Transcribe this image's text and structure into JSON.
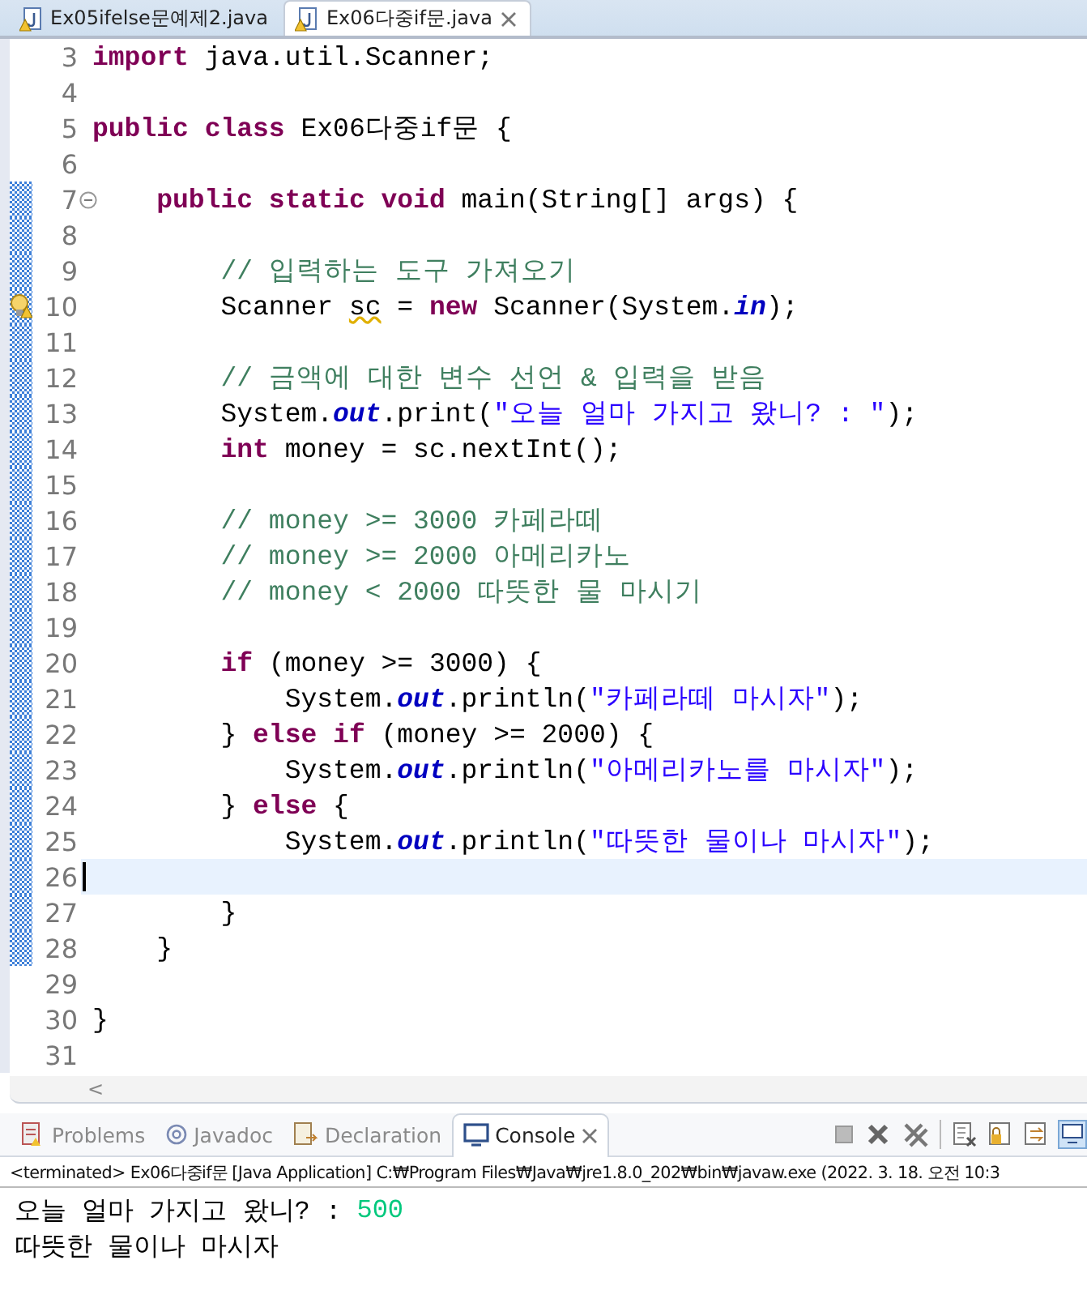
{
  "editor_tabs": [
    {
      "label": "Ex05ifelse문예제2.java",
      "selected": false
    },
    {
      "label": "Ex06다중if문.java",
      "selected": true
    }
  ],
  "code_lines": [
    {
      "number": "3",
      "kind": "code",
      "range": false,
      "current": false,
      "tokens": [
        {
          "kind": "kw",
          "text": "import"
        },
        {
          "kind": "plain",
          "text": " java.util.Scanner;"
        }
      ]
    },
    {
      "number": "4",
      "kind": "code",
      "range": false,
      "current": false
    },
    {
      "number": "5",
      "kind": "code",
      "range": false,
      "current": false,
      "tokens": [
        {
          "kind": "kw",
          "text": "public"
        },
        {
          "kind": "kw",
          "text": " class"
        },
        {
          "kind": "plain",
          "text": " Ex06다중if문 {"
        }
      ]
    },
    {
      "number": "6",
      "kind": "code",
      "range": false,
      "current": false
    },
    {
      "number": "7",
      "kind": "fold",
      "range": true,
      "current": false,
      "tokens": [
        {
          "kind": "kw",
          "text": "    public"
        },
        {
          "kind": "kw",
          "text": " static"
        },
        {
          "kind": "kw",
          "text": " void"
        },
        {
          "kind": "plain",
          "text": " main(String[] args) {"
        }
      ]
    },
    {
      "number": "8",
      "kind": "code",
      "range": true,
      "current": false
    },
    {
      "number": "9",
      "kind": "code",
      "range": true,
      "current": false,
      "tokens": [
        {
          "kind": "comment",
          "text": "        // 입력하는 도구 가져오기"
        }
      ]
    },
    {
      "number": "10",
      "kind": "warning",
      "range": true,
      "current": false,
      "tokens": [
        {
          "kind": "plain",
          "text": "        Scanner "
        },
        {
          "kind": "warn",
          "text": "sc"
        },
        {
          "kind": "plain",
          "text": " = "
        },
        {
          "kind": "kw",
          "text": "new"
        },
        {
          "kind": "plain",
          "text": " Scanner(System."
        },
        {
          "kind": "field",
          "text": "in"
        },
        {
          "kind": "plain",
          "text": ");"
        }
      ]
    },
    {
      "number": "11",
      "kind": "code",
      "range": true,
      "current": false
    },
    {
      "number": "12",
      "kind": "code",
      "range": true,
      "current": false,
      "tokens": [
        {
          "kind": "comment",
          "text": "        // 금액에 대한 변수 선언 & 입력을 받음"
        }
      ]
    },
    {
      "number": "13",
      "kind": "code",
      "range": true,
      "current": false,
      "tokens": [
        {
          "kind": "plain",
          "text": "        System."
        },
        {
          "kind": "field",
          "text": "out"
        },
        {
          "kind": "plain",
          "text": ".print("
        },
        {
          "kind": "str",
          "text": "\"오늘 얼마 가지고 왔니? : \""
        },
        {
          "kind": "plain",
          "text": ");"
        }
      ]
    },
    {
      "number": "14",
      "kind": "code",
      "range": true,
      "current": false,
      "tokens": [
        {
          "kind": "kw",
          "text": "        int"
        },
        {
          "kind": "plain",
          "text": " money = sc.nextInt();"
        }
      ]
    },
    {
      "number": "15",
      "kind": "code",
      "range": true,
      "current": false
    },
    {
      "number": "16",
      "kind": "code",
      "range": true,
      "current": false,
      "tokens": [
        {
          "kind": "comment",
          "text": "        // money >= 3000 카페라떼"
        }
      ]
    },
    {
      "number": "17",
      "kind": "code",
      "range": true,
      "current": false,
      "tokens": [
        {
          "kind": "comment",
          "text": "        // money >= 2000 아메리카노"
        }
      ]
    },
    {
      "number": "18",
      "kind": "code",
      "range": true,
      "current": false,
      "tokens": [
        {
          "kind": "comment",
          "text": "        // money < 2000 따뜻한 물 마시기"
        }
      ]
    },
    {
      "number": "19",
      "kind": "code",
      "range": true,
      "current": false
    },
    {
      "number": "20",
      "kind": "code",
      "range": true,
      "current": false,
      "tokens": [
        {
          "kind": "kw",
          "text": "        if"
        },
        {
          "kind": "plain",
          "text": " (money >= 3000) {"
        }
      ]
    },
    {
      "number": "21",
      "kind": "code",
      "range": true,
      "current": false,
      "tokens": [
        {
          "kind": "plain",
          "text": "            System."
        },
        {
          "kind": "field",
          "text": "out"
        },
        {
          "kind": "plain",
          "text": ".println("
        },
        {
          "kind": "str",
          "text": "\"카페라떼 마시자\""
        },
        {
          "kind": "plain",
          "text": ");"
        }
      ]
    },
    {
      "number": "22",
      "kind": "code",
      "range": true,
      "current": false,
      "tokens": [
        {
          "kind": "plain",
          "text": "        } "
        },
        {
          "kind": "kw",
          "text": "else"
        },
        {
          "kind": "kw",
          "text": " if"
        },
        {
          "kind": "plain",
          "text": " (money >= 2000) {"
        }
      ]
    },
    {
      "number": "23",
      "kind": "code",
      "range": true,
      "current": false,
      "tokens": [
        {
          "kind": "plain",
          "text": "            System."
        },
        {
          "kind": "field",
          "text": "out"
        },
        {
          "kind": "plain",
          "text": ".println("
        },
        {
          "kind": "str",
          "text": "\"아메리카노를 마시자\""
        },
        {
          "kind": "plain",
          "text": ");"
        }
      ]
    },
    {
      "number": "24",
      "kind": "code",
      "range": true,
      "current": false,
      "tokens": [
        {
          "kind": "plain",
          "text": "        } "
        },
        {
          "kind": "kw",
          "text": "else"
        },
        {
          "kind": "plain",
          "text": " {"
        }
      ]
    },
    {
      "number": "25",
      "kind": "code",
      "range": true,
      "current": false,
      "tokens": [
        {
          "kind": "plain",
          "text": "            System."
        },
        {
          "kind": "field",
          "text": "out"
        },
        {
          "kind": "plain",
          "text": ".println("
        },
        {
          "kind": "str",
          "text": "\"따뜻한 물이나 마시자\""
        },
        {
          "kind": "plain",
          "text": ");"
        }
      ]
    },
    {
      "number": "26",
      "kind": "code",
      "range": true,
      "current": true
    },
    {
      "number": "27",
      "kind": "code",
      "range": true,
      "current": false,
      "tokens": [
        {
          "kind": "plain",
          "text": "        }"
        }
      ]
    },
    {
      "number": "28",
      "kind": "code",
      "range": true,
      "current": false,
      "tokens": [
        {
          "kind": "plain",
          "text": "    }"
        }
      ]
    },
    {
      "number": "29",
      "kind": "code",
      "range": false,
      "current": false
    },
    {
      "number": "30",
      "kind": "code",
      "range": false,
      "current": false,
      "tokens": [
        {
          "kind": "plain",
          "text": "}"
        }
      ]
    },
    {
      "number": "31",
      "kind": "code",
      "range": false,
      "current": false
    }
  ],
  "scroll_left": "<",
  "view_tabs": [
    {
      "label": "Problems",
      "selected": false
    },
    {
      "label": "Javadoc",
      "selected": false
    },
    {
      "label": "Declaration",
      "selected": false
    },
    {
      "label": "Console",
      "selected": true
    }
  ],
  "console_status": "<terminated> Ex06다중if문 [Java Application] C:₩Program Files₩Java₩jre1.8.0_202₩bin₩javaw.exe (2022. 3. 18. 오전 10:3",
  "console_output": [
    [
      {
        "kind": "out",
        "text": "오늘 얼마 가지고 왔니? : "
      },
      {
        "kind": "in",
        "text": "500"
      }
    ],
    [
      {
        "kind": "out",
        "text": "따뜻한 물이나 마시자"
      }
    ]
  ]
}
